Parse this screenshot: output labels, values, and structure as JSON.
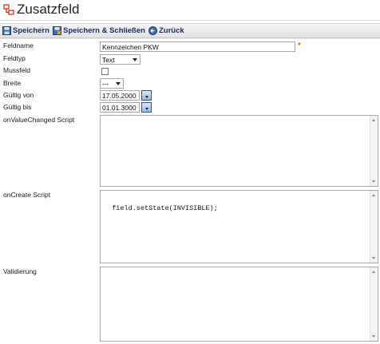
{
  "window": {
    "title": "Zusatzfeld",
    "icon": "tree-structure-icon"
  },
  "toolbar": {
    "save_label": "Speichern",
    "save_close_label": "Speichern & Schließen",
    "back_label": "Zurück"
  },
  "form": {
    "feldname_label": "Feldname",
    "feldname_value": "Kennzeichen PKW",
    "required_marker": "*",
    "feldtyp_label": "Feldtyp",
    "feldtyp_value": "Text",
    "mussfeld_label": "Mussfeld",
    "mussfeld_checked": false,
    "breite_label": "Breite",
    "breite_value": "---",
    "gueltig_von_label": "Gültig von",
    "gueltig_von_value": "17.05.2000",
    "gueltig_bis_label": "Gültig bis",
    "gueltig_bis_value": "01.01.3000",
    "on_value_changed_label": "onValueChanged Script",
    "on_value_changed_value": "",
    "on_create_label": "onCreate Script",
    "on_create_value": "field.setState(INVISIBLE);",
    "validierung_label": "Validierung",
    "validierung_value": ""
  },
  "colors": {
    "accent": "#1a2a5a",
    "required": "#e07000",
    "title_icon": "#cc2200"
  }
}
